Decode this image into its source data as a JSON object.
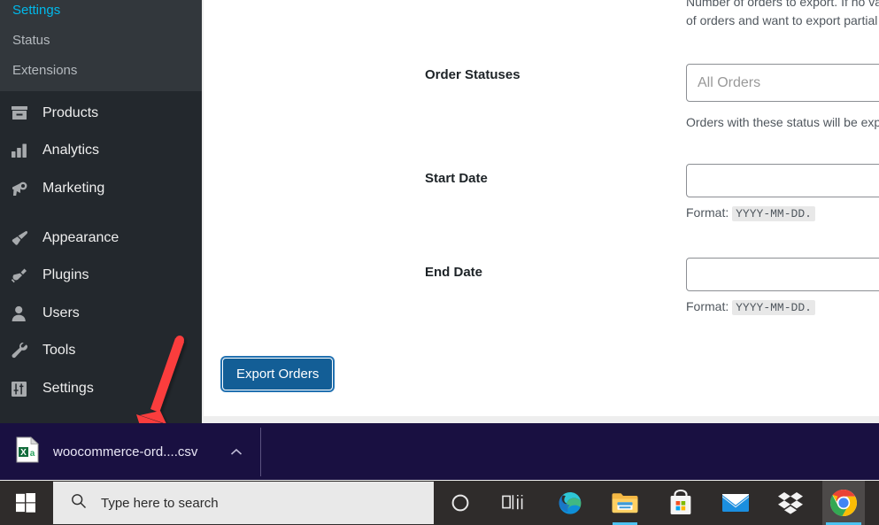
{
  "sidebar": {
    "submenu_items": [
      {
        "label": "Settings",
        "name": "sidebar-submenu-settings"
      },
      {
        "label": "Status",
        "name": "sidebar-submenu-status"
      },
      {
        "label": "Extensions",
        "name": "sidebar-submenu-extensions"
      }
    ],
    "menu_items": [
      {
        "label": "Products",
        "icon": "products-box-icon",
        "name": "sidebar-item-products"
      },
      {
        "label": "Analytics",
        "icon": "analytics-chart-icon",
        "name": "sidebar-item-analytics"
      },
      {
        "label": "Marketing",
        "icon": "marketing-megaphone-icon",
        "name": "sidebar-item-marketing"
      },
      {
        "label": "Appearance",
        "icon": "appearance-brush-icon",
        "name": "sidebar-item-appearance"
      },
      {
        "label": "Plugins",
        "icon": "plugins-plug-icon",
        "name": "sidebar-item-plugins"
      },
      {
        "label": "Users",
        "icon": "users-person-icon",
        "name": "sidebar-item-users"
      },
      {
        "label": "Tools",
        "icon": "tools-wrench-icon",
        "name": "sidebar-item-tools"
      },
      {
        "label": "Settings",
        "icon": "settings-sliders-icon",
        "name": "sidebar-item-settings"
      }
    ]
  },
  "form": {
    "top_description_line1": "Number of orders to export. If no value is given all orders will be exp",
    "top_description_line2": "of orders and want to export partial list of orders.",
    "order_statuses": {
      "label": "Order Statuses",
      "placeholder": "All Orders",
      "value": "",
      "description": "Orders with these status will be exported."
    },
    "start_date": {
      "label": "Start Date",
      "value": "",
      "format_prefix": "Format:",
      "format_code": "YYYY-MM-DD."
    },
    "end_date": {
      "label": "End Date",
      "value": "",
      "format_prefix": "Format:",
      "format_code": "YYYY-MM-DD."
    },
    "submit_button": "Export Orders"
  },
  "downloads_bar": {
    "file_name": "woocommerce-ord....csv",
    "file_icon": "excel-csv-file-icon",
    "menu_icon": "chevron-up-icon"
  },
  "taskbar": {
    "start_icon": "windows-start-icon",
    "search_placeholder": "Type here to search",
    "search_icon": "search-icon",
    "icons": [
      {
        "name": "cortana-icon",
        "title": "Cortana"
      },
      {
        "name": "task-view-icon",
        "title": "Task View"
      },
      {
        "name": "microsoft-edge-icon",
        "title": "Microsoft Edge"
      },
      {
        "name": "file-explorer-icon",
        "title": "File Explorer"
      },
      {
        "name": "microsoft-store-icon",
        "title": "Microsoft Store"
      },
      {
        "name": "mail-icon",
        "title": "Mail"
      },
      {
        "name": "dropbox-icon",
        "title": "Dropbox"
      },
      {
        "name": "google-chrome-icon",
        "title": "Google Chrome"
      }
    ]
  },
  "colors": {
    "wp_sidebar": "#23282d",
    "wp_submenu": "#32373c",
    "primary_button": "#135e96",
    "focus_ring": "#2271b1",
    "download_bar": "#191041",
    "taskbar": "#2f2c2b",
    "annotation_arrow": "#fa3c3c"
  }
}
